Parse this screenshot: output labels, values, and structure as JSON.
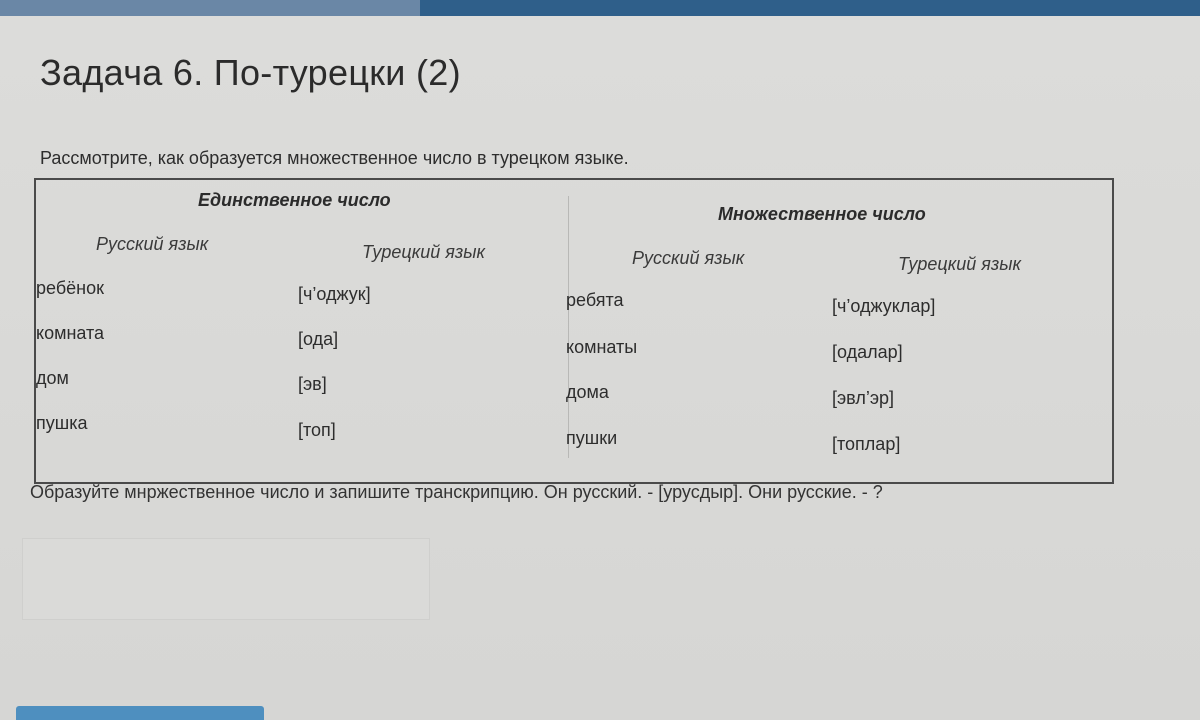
{
  "task": {
    "title": "Задача 6. По-турецки (2)",
    "instruction": "Рассмотрите, как образуется множественное число в турецком языке.",
    "question": "Образуйте мнржественное число и запишите транскрипцию. Он русский. - [урусдыр]. Они русские. - ?"
  },
  "table": {
    "singular_header": "Единственное число",
    "plural_header": "Множественное число",
    "col_ru": "Русский язык",
    "col_tr": "Турецкий язык",
    "rows": [
      {
        "sg_ru": "ребёнок",
        "sg_tr": "[ч’оджук]",
        "pl_ru": "ребята",
        "pl_tr": "[ч’оджуклар]"
      },
      {
        "sg_ru": "комната",
        "sg_tr": "[ода]",
        "pl_ru": "комнаты",
        "pl_tr": "[одалар]"
      },
      {
        "sg_ru": "дом",
        "sg_tr": "[эв]",
        "pl_ru": "дома",
        "pl_tr": "[эвл’эр]"
      },
      {
        "sg_ru": "пушка",
        "sg_tr": "[топ]",
        "pl_ru": "пушки",
        "pl_tr": "[топлар]"
      }
    ]
  },
  "answer": {
    "value": ""
  },
  "colors": {
    "top_bar": "#2f5f8a",
    "button": "#4e8fbf"
  }
}
